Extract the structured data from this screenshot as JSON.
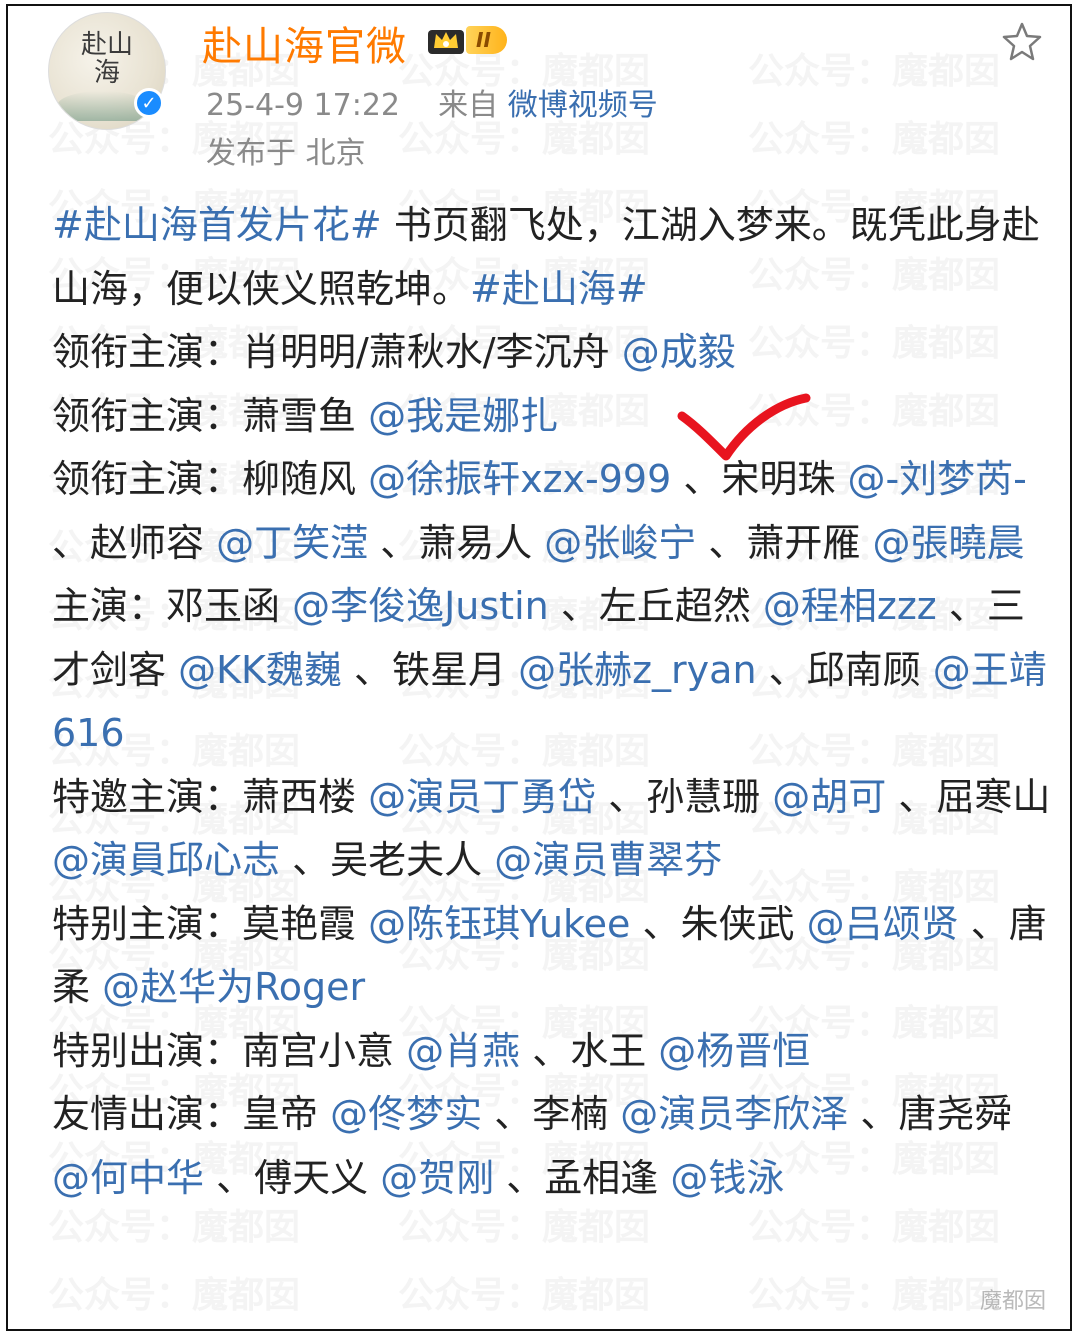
{
  "header": {
    "username": "赴山海官微",
    "level_badge": "II",
    "timestamp": "25-4-9 17:22",
    "from_label": "来自",
    "source": "微博视频号",
    "location": "发布于 北京",
    "avatar_text": "赴山海",
    "verified_mark": "✓"
  },
  "post": {
    "lines": [
      {
        "parts": [
          {
            "t": "tag",
            "v": "#赴山海首发片花#"
          },
          {
            "t": "text",
            "v": " 书页翻飞处，江湖入梦来。既凭此身赴山海，便以侠义照乾坤。"
          },
          {
            "t": "tag",
            "v": "#赴山海#"
          }
        ]
      },
      {
        "parts": [
          {
            "t": "text",
            "v": "领衔主演：肖明明/萧秋水/李沉舟 "
          },
          {
            "t": "at",
            "v": "@成毅"
          }
        ]
      },
      {
        "parts": [
          {
            "t": "text",
            "v": "领衔主演：萧雪鱼 "
          },
          {
            "t": "at",
            "v": "@我是娜扎"
          }
        ]
      },
      {
        "parts": [
          {
            "t": "text",
            "v": "领衔主演：柳随风 "
          },
          {
            "t": "at",
            "v": "@徐振轩xzx-999"
          },
          {
            "t": "text",
            "v": " 、宋明珠 "
          },
          {
            "t": "at",
            "v": "@-刘梦芮-"
          },
          {
            "t": "text",
            "v": " 、赵师容 "
          },
          {
            "t": "at",
            "v": "@丁笑滢"
          },
          {
            "t": "text",
            "v": " 、萧易人 "
          },
          {
            "t": "at",
            "v": "@张峻宁"
          },
          {
            "t": "text",
            "v": " 、萧开雁 "
          },
          {
            "t": "at",
            "v": "@張曉晨"
          }
        ]
      },
      {
        "parts": [
          {
            "t": "text",
            "v": "主演：邓玉函 "
          },
          {
            "t": "at",
            "v": "@李俊逸Justin"
          },
          {
            "t": "text",
            "v": " 、左丘超然 "
          },
          {
            "t": "at",
            "v": "@程相zzz"
          },
          {
            "t": "text",
            "v": " 、三才剑客 "
          },
          {
            "t": "at",
            "v": "@KK魏巍"
          },
          {
            "t": "text",
            "v": " 、铁星月 "
          },
          {
            "t": "at",
            "v": "@张赫z_ryan"
          },
          {
            "t": "text",
            "v": " 、邱南顾 "
          },
          {
            "t": "at",
            "v": "@王靖616"
          }
        ]
      },
      {
        "parts": [
          {
            "t": "text",
            "v": "特邀主演：萧西楼 "
          },
          {
            "t": "at",
            "v": "@演员丁勇岱"
          },
          {
            "t": "text",
            "v": " 、孙慧珊 "
          },
          {
            "t": "at",
            "v": "@胡可"
          },
          {
            "t": "text",
            "v": " 、屈寒山 "
          },
          {
            "t": "at",
            "v": "@演員邱心志"
          },
          {
            "t": "text",
            "v": " 、吴老夫人 "
          },
          {
            "t": "at",
            "v": "@演员曹翠芬"
          }
        ]
      },
      {
        "parts": [
          {
            "t": "text",
            "v": "特别主演：莫艳霞 "
          },
          {
            "t": "at",
            "v": "@陈钰琪Yukee"
          },
          {
            "t": "text",
            "v": " 、朱侠武 "
          },
          {
            "t": "at",
            "v": "@吕颂贤"
          },
          {
            "t": "text",
            "v": " 、唐柔 "
          },
          {
            "t": "at",
            "v": "@赵华为Roger"
          }
        ]
      },
      {
        "parts": [
          {
            "t": "text",
            "v": "特别出演：南宫小意 "
          },
          {
            "t": "at",
            "v": "@肖燕"
          },
          {
            "t": "text",
            "v": " 、水王 "
          },
          {
            "t": "at",
            "v": "@杨晋恒"
          }
        ]
      },
      {
        "parts": [
          {
            "t": "text",
            "v": "友情出演：皇帝 "
          },
          {
            "t": "at",
            "v": "@佟梦实"
          },
          {
            "t": "text",
            "v": " 、李楠 "
          },
          {
            "t": "at",
            "v": "@演员李欣泽"
          },
          {
            "t": "text",
            "v": " 、唐尧舜 "
          },
          {
            "t": "at",
            "v": "@何中华"
          },
          {
            "t": "text",
            "v": " 、傅天义 "
          },
          {
            "t": "at",
            "v": "@贺刚"
          },
          {
            "t": "text",
            "v": " 、孟相逢 "
          },
          {
            "t": "at",
            "v": "@钱泳"
          }
        ]
      }
    ]
  },
  "watermark": {
    "text_a": "公众号：",
    "text_b": "魔都囡"
  },
  "corner_watermark": "魔都囡",
  "icons": {
    "star": "star-outline-icon",
    "crown": "crown-icon",
    "check": "red-checkmark-icon"
  },
  "colors": {
    "username": "#ff7a00",
    "link": "#3a6fb0",
    "verified": "#1a8cff",
    "check": "#e8141f"
  }
}
